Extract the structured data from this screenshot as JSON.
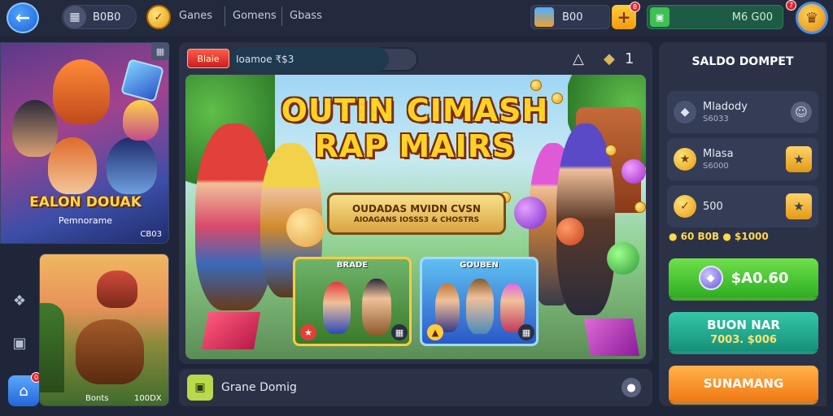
{
  "topbar": {
    "back_icon": "arrow-left-icon",
    "account_chip": {
      "icon": "controller-icon",
      "value": "B0B0"
    },
    "coin_chip": {
      "icon": "coin-icon"
    },
    "nav": [
      "Ganes",
      "Gomens",
      "Gbass"
    ],
    "resource_chip": {
      "icon": "chest-icon",
      "value": "B00"
    },
    "plus_badge": "8",
    "wallet": {
      "icon": "wallet-icon",
      "value": "M6 G00"
    },
    "profile_badge": "7"
  },
  "left": {
    "hero_card": {
      "title": "EALON DOUAK",
      "subtitle": "Pemnorame",
      "price": "CB03"
    },
    "side_icons": [
      "puzzle-icon",
      "camera-icon"
    ],
    "home_badge": "0",
    "promo_card": {
      "left": "Bonts",
      "right": "100DX"
    }
  },
  "center": {
    "event_tag": "Blaie",
    "event_text": "Ioamoe ₹$3",
    "header_icons": [
      "alert-icon",
      "gift-icon",
      "1"
    ],
    "banner": {
      "title_line1": "OUTIN CIMASH",
      "title_line2": "RAP MAIRS",
      "ribbon_main": "OUDADAS MVIDN CVSN",
      "ribbon_sub": "AIOAGANS IOSSS3 & CHOSTRS"
    },
    "mode_cards": [
      {
        "title": "BRADE"
      },
      {
        "title": "GOUBEN"
      }
    ],
    "game_row": {
      "label": "Grane Domig"
    }
  },
  "right": {
    "title": "SALDO DOMPET",
    "rows": [
      {
        "name": "Mladody",
        "value": "S6033"
      },
      {
        "name": "Mlasa",
        "value": "S6000"
      },
      {
        "name": "500",
        "value": ""
      }
    ],
    "balance": "● 60  B0B  ● $1000",
    "green_button": "$A0.60",
    "teal_button": {
      "main": "BUON NAR",
      "sub": "7003. $006"
    },
    "orange_button": "SUNAMANG"
  }
}
